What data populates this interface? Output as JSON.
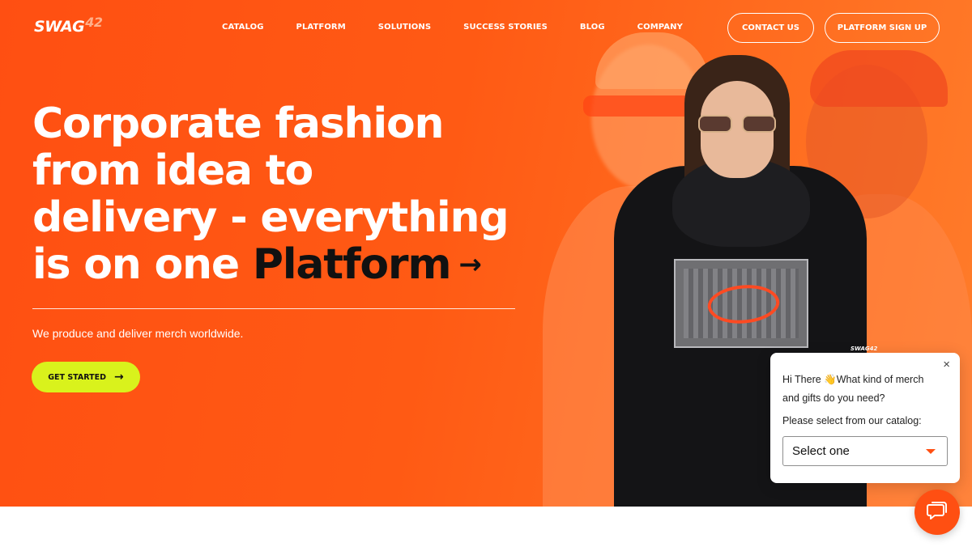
{
  "header": {
    "logo_text": "SWAG",
    "logo_number": "42",
    "nav": [
      "CATALOG",
      "PLATFORM",
      "SOLUTIONS",
      "SUCCESS STORIES",
      "BLOG",
      "COMPANY"
    ],
    "contact_label": "CONTACT US",
    "signup_label": "PLATFORM SIGN UP"
  },
  "hero": {
    "headline_line1": "Corporate fashion",
    "headline_line2": "from idea to",
    "headline_line3": "delivery - everything",
    "headline_line4_prefix": "is on one",
    "headline_highlight": "Platform",
    "arrow": "→",
    "subtext": "We produce and deliver merch worldwide.",
    "cta_label": "GET STARTED",
    "cta_arrow": "→",
    "hoodie_tag": "SWAG42"
  },
  "chat": {
    "close": "×",
    "greeting_line1": "Hi There 👋What kind of merch",
    "greeting_line2": "and gifts do you need?",
    "prompt": "Please select from our catalog:",
    "select_value": "Select one"
  },
  "colors": {
    "brand_orange": "#ff4f12",
    "cta_lime": "#d9f21c",
    "text_dark": "#111111"
  },
  "icons": {
    "chat_launcher": "chat-bubble-icon",
    "close": "close-icon",
    "dropdown": "chevron-down-icon"
  }
}
